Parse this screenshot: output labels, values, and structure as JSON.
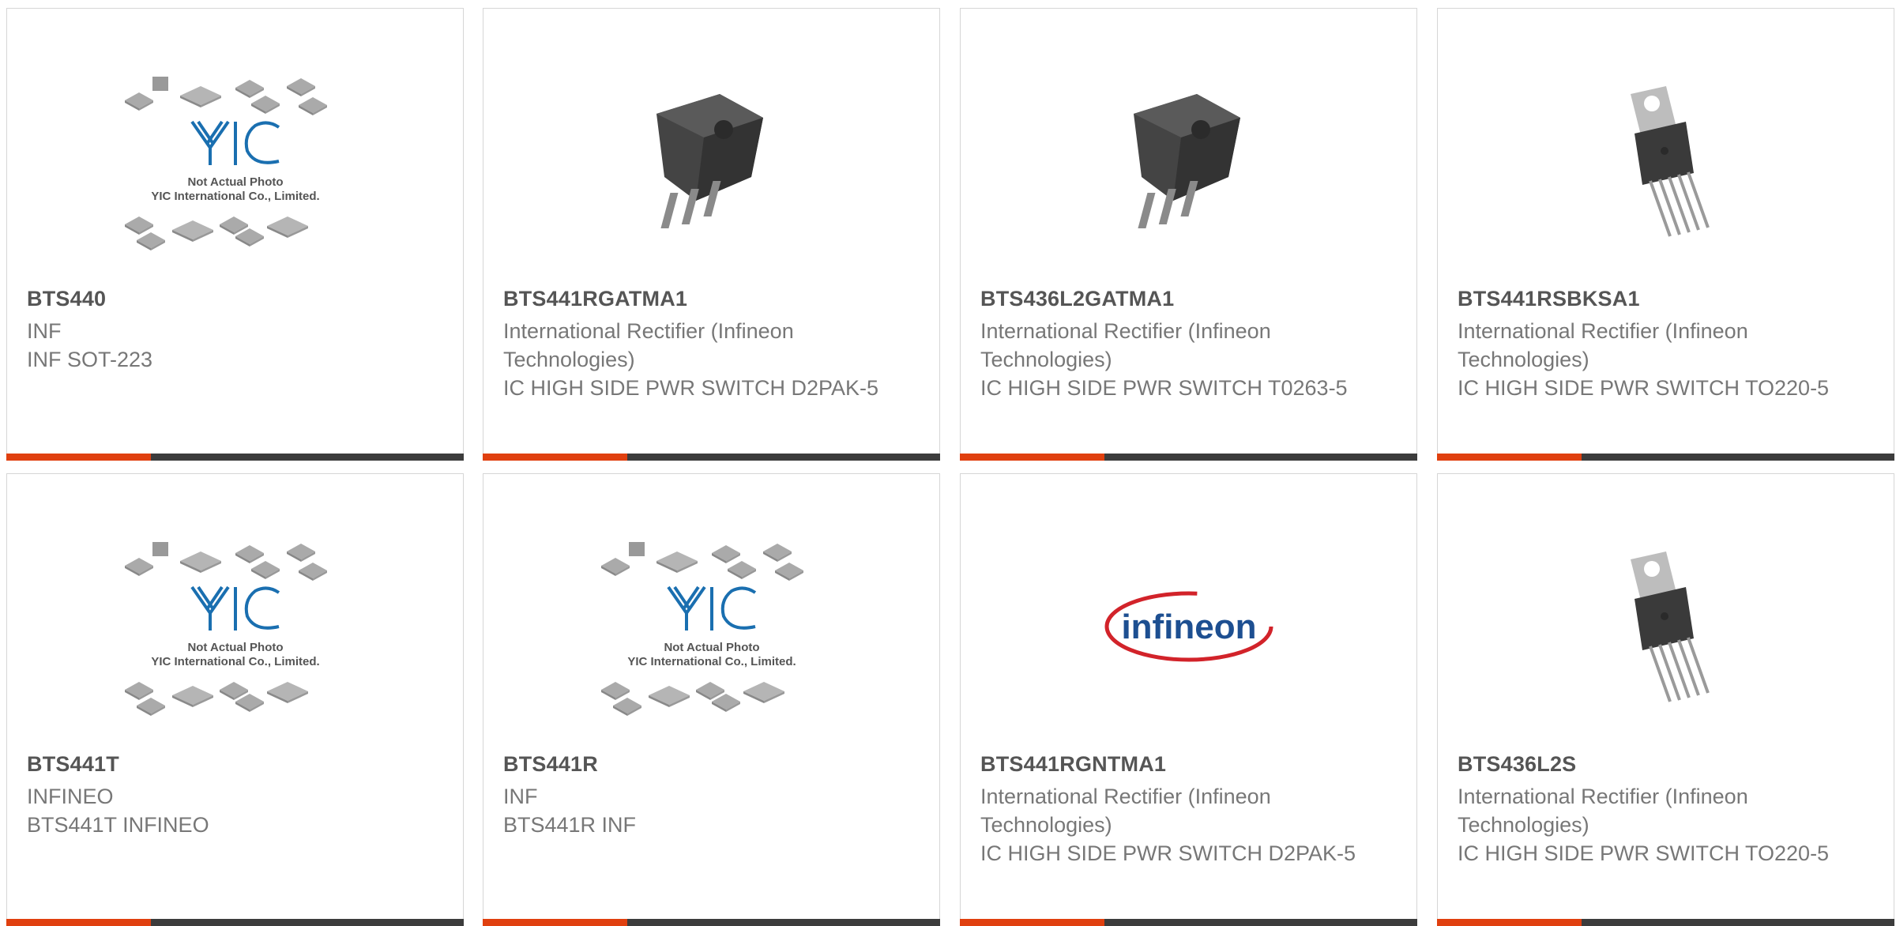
{
  "colors": {
    "accent": "#e0400f",
    "bar": "#3c3c3c",
    "title": "#555555",
    "desc": "#777777"
  },
  "products": [
    {
      "name": "BTS440",
      "line1": "INF",
      "line2": "INF SOT-223",
      "image": "yic-placeholder-image",
      "placeholder_text_1": "Not Actual Photo",
      "placeholder_text_2": "YIC International Co., Limited."
    },
    {
      "name": "BTS441RGATMA1",
      "line1": "International Rectifier (Infineon Technologies)",
      "line2": "IC HIGH SIDE PWR SWITCH D2PAK-5",
      "image": "d2pak-package-image"
    },
    {
      "name": "BTS436L2GATMA1",
      "line1": "International Rectifier (Infineon Technologies)",
      "line2": "IC HIGH SIDE PWR SWITCH T0263-5",
      "image": "d2pak-package-image"
    },
    {
      "name": "BTS441RSBKSA1",
      "line1": "International Rectifier (Infineon Technologies)",
      "line2": "IC HIGH SIDE PWR SWITCH TO220-5",
      "image": "to220-package-image"
    },
    {
      "name": "BTS441T",
      "line1": "INFINEO",
      "line2": "BTS441T INFINEO",
      "image": "yic-placeholder-image",
      "placeholder_text_1": "Not Actual Photo",
      "placeholder_text_2": "YIC International Co., Limited."
    },
    {
      "name": "BTS441R",
      "line1": "INF",
      "line2": "BTS441R INF",
      "image": "yic-placeholder-image",
      "placeholder_text_1": "Not Actual Photo",
      "placeholder_text_2": "YIC International Co., Limited."
    },
    {
      "name": "BTS441RGNTMA1",
      "line1": "International Rectifier (Infineon Technologies)",
      "line2": "IC HIGH SIDE PWR SWITCH D2PAK-5",
      "image": "infineon-logo-image",
      "logo_text": "infineon"
    },
    {
      "name": "BTS436L2S",
      "line1": "International Rectifier (Infineon Technologies)",
      "line2": "IC HIGH SIDE PWR SWITCH TO220-5",
      "image": "to220-package-image"
    }
  ]
}
